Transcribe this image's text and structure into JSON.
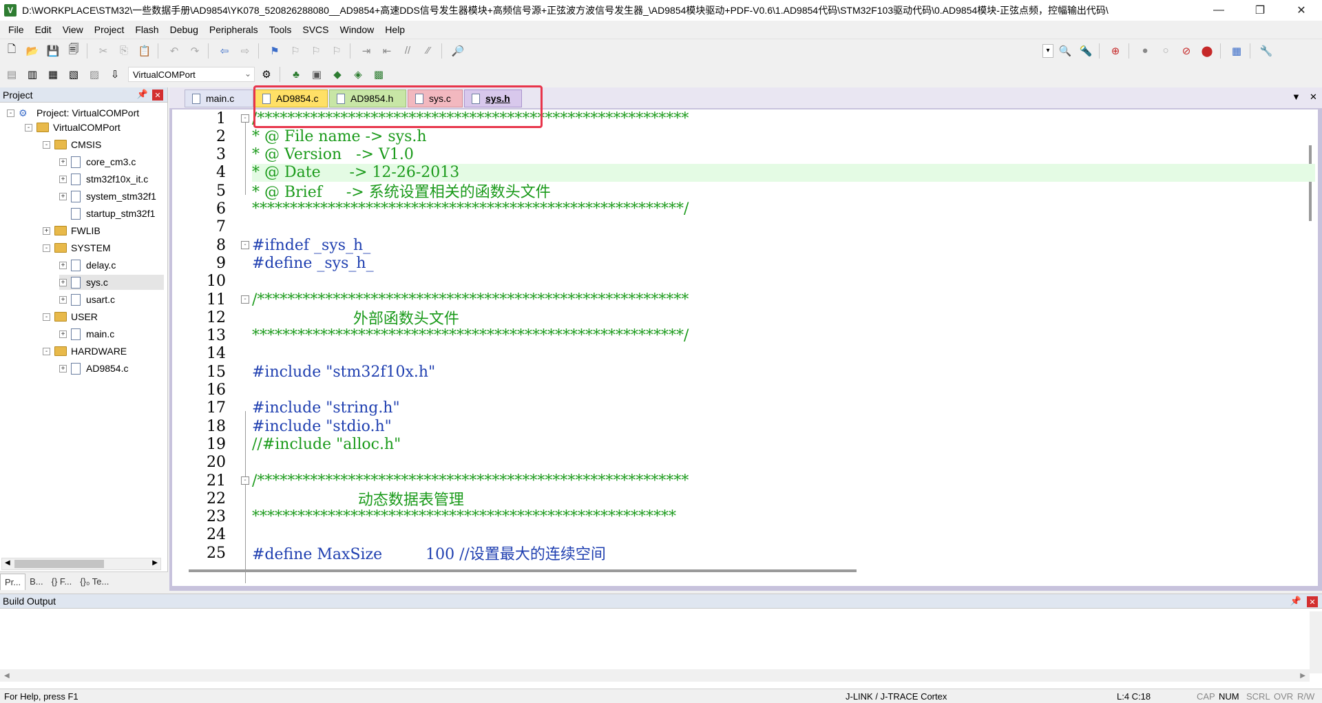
{
  "window": {
    "icon": "V",
    "title": "D:\\WORKPLACE\\STM32\\一些数据手册\\AD9854\\YK078_520826288080__AD9854+高速DDS信号发生器模块+高频信号源+正弦波方波信号发生器_\\AD9854模块驱动+PDF-V0.6\\1.AD9854代码\\STM32F103驱动代码\\0.AD9854模块-正弦点频，控幅输出代码\\",
    "minimize": "—",
    "restore": "❐",
    "close": "✕"
  },
  "menu": [
    "File",
    "Edit",
    "View",
    "Project",
    "Flash",
    "Debug",
    "Peripherals",
    "Tools",
    "SVCS",
    "Window",
    "Help"
  ],
  "toolbar": {
    "target": "VirtualCOMPort"
  },
  "project_panel": {
    "title": "Project",
    "pin": "📌",
    "close": "✕",
    "tree": [
      {
        "label": "Project: VirtualCOMPort",
        "type": "project",
        "expander": "-"
      },
      {
        "label": "VirtualCOMPort",
        "type": "target",
        "expander": "-"
      },
      {
        "label": "CMSIS",
        "type": "folder",
        "expander": "-"
      },
      {
        "label": "core_cm3.c",
        "type": "file",
        "expander": "+"
      },
      {
        "label": "stm32f10x_it.c",
        "type": "file",
        "expander": "+"
      },
      {
        "label": "system_stm32f1",
        "type": "file",
        "expander": "+"
      },
      {
        "label": "startup_stm32f1",
        "type": "file",
        "expander": ""
      },
      {
        "label": "FWLIB",
        "type": "folder",
        "expander": "+"
      },
      {
        "label": "SYSTEM",
        "type": "folder",
        "expander": "-"
      },
      {
        "label": "delay.c",
        "type": "file",
        "expander": "+"
      },
      {
        "label": "sys.c",
        "type": "file",
        "expander": "+",
        "selected": true
      },
      {
        "label": "usart.c",
        "type": "file",
        "expander": "+"
      },
      {
        "label": "USER",
        "type": "folder",
        "expander": "-"
      },
      {
        "label": "main.c",
        "type": "file",
        "expander": "+"
      },
      {
        "label": "HARDWARE",
        "type": "folder",
        "expander": "-"
      },
      {
        "label": "AD9854.c",
        "type": "file",
        "expander": "+"
      }
    ],
    "tabs": [
      "Pr...",
      "B...",
      "{} F...",
      "{}₀ Te..."
    ]
  },
  "editor": {
    "tabs": [
      {
        "label": "main.c"
      },
      {
        "label": "AD9854.c"
      },
      {
        "label": "AD9854.h"
      },
      {
        "label": "sys.c"
      },
      {
        "label": "sys.h",
        "active": true
      }
    ],
    "lines": [
      {
        "n": "1",
        "text": "/*********************************************************",
        "color": "green",
        "fold": "-"
      },
      {
        "n": "2",
        "text": "* @ File name -> sys.h",
        "color": "green"
      },
      {
        "n": "3",
        "text": "* @ Version   -> V1.0",
        "color": "green"
      },
      {
        "n": "4",
        "text": "* @ Date      -> 12-26-2013",
        "color": "green",
        "highlight": true
      },
      {
        "n": "5",
        "text": "* @ Brief     -> 系统设置相关的函数头文件",
        "color": "green"
      },
      {
        "n": "6",
        "text": "*********************************************************/",
        "color": "green"
      },
      {
        "n": "7",
        "text": "",
        "color": "green"
      },
      {
        "n": "8",
        "text": "#ifndef _sys_h_",
        "color": "blue",
        "fold": "-"
      },
      {
        "n": "9",
        "text": "#define _sys_h_",
        "color": "blue"
      },
      {
        "n": "10",
        "text": "",
        "color": "green"
      },
      {
        "n": "11",
        "text": "/*********************************************************",
        "color": "green",
        "fold": "-"
      },
      {
        "n": "12",
        "text": "                     外部函数头文件",
        "color": "green"
      },
      {
        "n": "13",
        "text": "*********************************************************/",
        "color": "green"
      },
      {
        "n": "14",
        "text": "",
        "color": "green"
      },
      {
        "n": "15",
        "text": "#include \"stm32f10x.h\"",
        "color": "blue"
      },
      {
        "n": "16",
        "text": "",
        "color": "green"
      },
      {
        "n": "17",
        "text": "#include \"string.h\"",
        "color": "blue"
      },
      {
        "n": "18",
        "text": "#include \"stdio.h\"",
        "color": "blue"
      },
      {
        "n": "19",
        "text": "//#include \"alloc.h\"",
        "color": "green"
      },
      {
        "n": "20",
        "text": "",
        "color": "green"
      },
      {
        "n": "21",
        "text": "/*********************************************************",
        "color": "green",
        "fold": "-"
      },
      {
        "n": "22",
        "text": "                      动态数据表管理",
        "color": "green"
      },
      {
        "n": "23",
        "text": "********************************************************",
        "color": "green"
      },
      {
        "n": "24",
        "text": "",
        "color": "green"
      },
      {
        "n": "25",
        "text": "#define MaxSize         100 //设置最大的连续空间",
        "color": "blue"
      }
    ]
  },
  "build_output": {
    "title": "Build Output",
    "pin": "📌",
    "close": "✕"
  },
  "statusbar": {
    "help": "For Help, press F1",
    "debugger": "J-LINK / J-TRACE Cortex",
    "position": "L:4 C:18",
    "indicators": [
      {
        "label": "CAP",
        "on": false
      },
      {
        "label": "NUM",
        "on": true
      },
      {
        "label": "SCRL",
        "on": false
      },
      {
        "label": "OVR",
        "on": false
      },
      {
        "label": "R/W",
        "on": false
      }
    ]
  },
  "colors": {
    "comment": "#1a9a1a",
    "preprocessor": "#1f3fb0",
    "highlight_line": "#e4fbe4",
    "annotation_box": "#e8344a"
  }
}
